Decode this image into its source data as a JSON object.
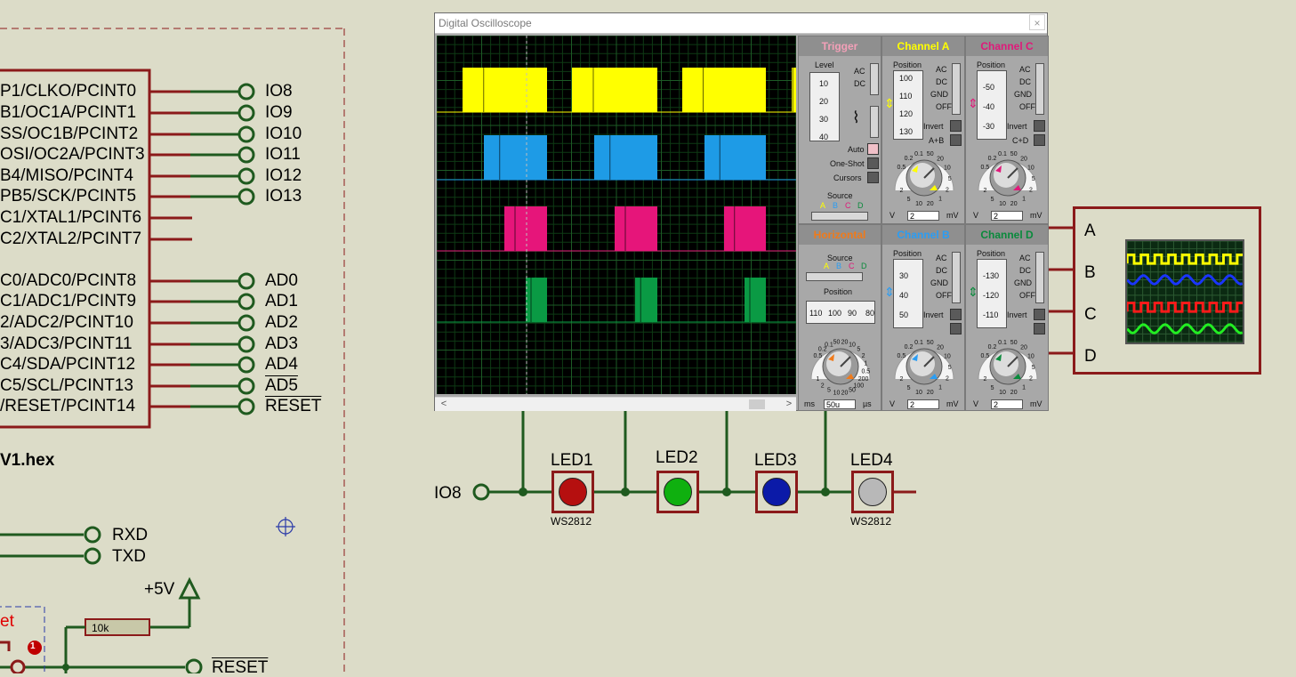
{
  "window": {
    "title": "Digital Oscilloscope",
    "close_label": "×"
  },
  "scrollbar": {
    "left_arrow": "<",
    "right_arrow": ">"
  },
  "trigger": {
    "title": "Trigger",
    "level_label": "Level",
    "drum_values": [
      "10",
      "20",
      "30",
      "40"
    ],
    "ac_label": "AC",
    "dc_label": "DC",
    "auto_label": "Auto",
    "oneshot_label": "One-Shot",
    "cursors_label": "Cursors",
    "source_label": "Source",
    "source_options": [
      "A",
      "B",
      "C",
      "D"
    ]
  },
  "horizontal": {
    "title": "Horizontal",
    "source_label": "Source",
    "source_options": [
      "A",
      "B",
      "C",
      "D"
    ],
    "position_label": "Position",
    "drum_values": [
      "110",
      "100",
      "90",
      "80"
    ],
    "knob_scale": [
      "0.5",
      "0.2",
      "0.1",
      "50",
      "20",
      "10",
      "5",
      "2",
      "1",
      "0.5",
      "200",
      "100",
      "50",
      "20",
      "10",
      "5",
      "2",
      "1"
    ],
    "unit_left": "ms",
    "value": "50u",
    "unit_right": "µs"
  },
  "channels": [
    {
      "title": "Channel A",
      "color": "#ffff00",
      "position_label": "Position",
      "drum_values": [
        "100",
        "110",
        "120",
        "130"
      ],
      "labels": [
        "AC",
        "DC",
        "GND",
        "OFF"
      ],
      "invert_label": "Invert",
      "combine_label": "A+B",
      "unit_left": "V",
      "value": "2",
      "unit_right": "mV",
      "knob_scale": [
        "0.5",
        "0.2",
        "0.1",
        "50",
        "20",
        "10",
        "5",
        "2",
        "1",
        "20",
        "10",
        "5",
        "2"
      ]
    },
    {
      "title": "Channel B",
      "color": "#2a9df4",
      "position_label": "Position",
      "drum_values": [
        "30",
        "40",
        "50"
      ],
      "labels": [
        "AC",
        "DC",
        "GND",
        "OFF"
      ],
      "invert_label": "Invert",
      "combine_label": "",
      "unit_left": "V",
      "value": "2",
      "unit_right": "mV",
      "knob_scale": [
        "0.5",
        "0.2",
        "0.1",
        "50",
        "20",
        "10",
        "5",
        "2",
        "1",
        "20",
        "10",
        "5",
        "2"
      ]
    },
    {
      "title": "Channel C",
      "color": "#e0197a",
      "position_label": "Position",
      "drum_values": [
        "-50",
        "-40",
        "-30"
      ],
      "labels": [
        "AC",
        "DC",
        "GND",
        "OFF"
      ],
      "invert_label": "Invert",
      "combine_label": "C+D",
      "unit_left": "V",
      "value": "2",
      "unit_right": "mV",
      "knob_scale": [
        "0.5",
        "0.2",
        "0.1",
        "50",
        "20",
        "10",
        "5",
        "2",
        "1",
        "20",
        "10",
        "5",
        "2"
      ]
    },
    {
      "title": "Channel D",
      "color": "#0a8a3c",
      "position_label": "Position",
      "drum_values": [
        "-130",
        "-120",
        "-110"
      ],
      "labels": [
        "AC",
        "DC",
        "GND",
        "OFF"
      ],
      "invert_label": "Invert",
      "combine_label": "",
      "unit_left": "V",
      "value": "2",
      "unit_right": "mV",
      "knob_scale": [
        "0.5",
        "0.2",
        "0.1",
        "50",
        "20",
        "10",
        "5",
        "2",
        "1",
        "20",
        "10",
        "5",
        "2"
      ]
    }
  ],
  "waveform_colors": {
    "A": "#ffff00",
    "B": "#1e9be6",
    "C": "#e6157a",
    "D": "#0a9a44"
  },
  "mcu": {
    "pins": [
      "P1/CLKO/PCINT0",
      "B1/OC1A/PCINT1",
      "SS/OC1B/PCINT2",
      "OSI/OC2A/PCINT3",
      "B4/MISO/PCINT4",
      "PB5/SCK/PCINT5",
      "C1/XTAL1/PCINT6",
      "C2/XTAL2/PCINT7",
      "C0/ADC0/PCINT8",
      "C1/ADC1/PCINT9",
      "2/ADC2/PCINT10",
      "3/ADC3/PCINT11",
      "C4/SDA/PCINT12",
      "C5/SCL/PCINT13",
      "/RESET/PCINT14"
    ],
    "terminals": [
      "IO8",
      "IO9",
      "IO10",
      "IO11",
      "IO12",
      "IO13",
      "AD0",
      "AD1",
      "AD2",
      "AD3",
      "AD4",
      "AD5",
      "RESET"
    ],
    "hex_label": "V1.hex"
  },
  "serial": {
    "rxd": "RXD",
    "txd": "TXD"
  },
  "power": {
    "vcc": "+5V",
    "resistor": "10k",
    "reset_label": "RESET",
    "button_label": "et"
  },
  "led_chain": {
    "input_label": "IO8",
    "leds": [
      {
        "name": "LED1",
        "color": "#b50f0f",
        "part": "WS2812"
      },
      {
        "name": "LED2",
        "color": "#0fb00f",
        "part": ""
      },
      {
        "name": "LED3",
        "color": "#0b1aa8",
        "part": ""
      },
      {
        "name": "LED4",
        "color": "#b8b8b8",
        "part": "WS2812"
      }
    ]
  },
  "logic_analyzer": {
    "channels": [
      "A",
      "B",
      "C",
      "D"
    ],
    "trace_colors": [
      "#ffff00",
      "#1a35ff",
      "#ff1a1a",
      "#22ee22"
    ]
  }
}
